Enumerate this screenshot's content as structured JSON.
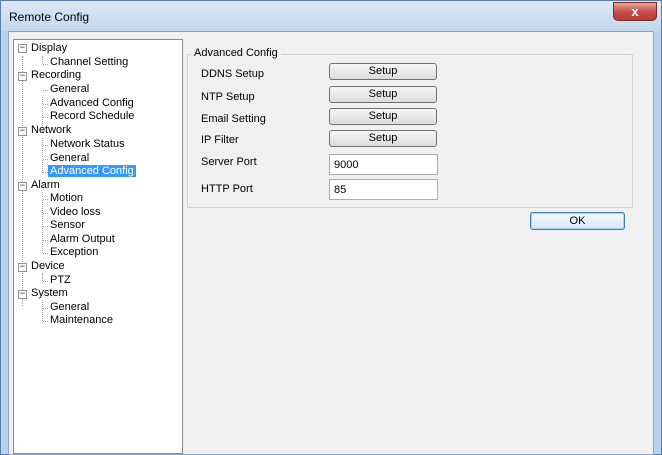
{
  "window": {
    "title": "Remote Config",
    "close_glyph": "x"
  },
  "tree": {
    "display": {
      "label": "Display",
      "children": [
        "Channel Setting"
      ]
    },
    "recording": {
      "label": "Recording",
      "children": [
        "General",
        "Advanced Config",
        "Record Schedule"
      ]
    },
    "network": {
      "label": "Network",
      "children": [
        "Network Status",
        "General",
        "Advanced Config"
      ]
    },
    "alarm": {
      "label": "Alarm",
      "children": [
        "Motion",
        "Video loss",
        "Sensor",
        "Alarm Output",
        "Exception"
      ]
    },
    "device": {
      "label": "Device",
      "children": [
        "PTZ"
      ]
    },
    "system": {
      "label": "System",
      "children": [
        "General",
        "Maintenance"
      ]
    },
    "expander_glyph": "−",
    "selected_item": "Network > Advanced Config"
  },
  "panel": {
    "group_title": "Advanced Config",
    "ddns_label": "DDNS Setup",
    "ntp_label": "NTP Setup",
    "email_label": "Email Setting",
    "ipfilter_label": "IP Filter",
    "setup_button": "Setup",
    "server_port_label": "Server Port",
    "server_port_value": "9000",
    "http_port_label": "HTTP Port",
    "http_port_value": "85"
  },
  "footer": {
    "ok_label": "OK"
  },
  "colors": {
    "selection": "#3399ff",
    "frame": "#b9d1ea",
    "close": "#c75050"
  }
}
